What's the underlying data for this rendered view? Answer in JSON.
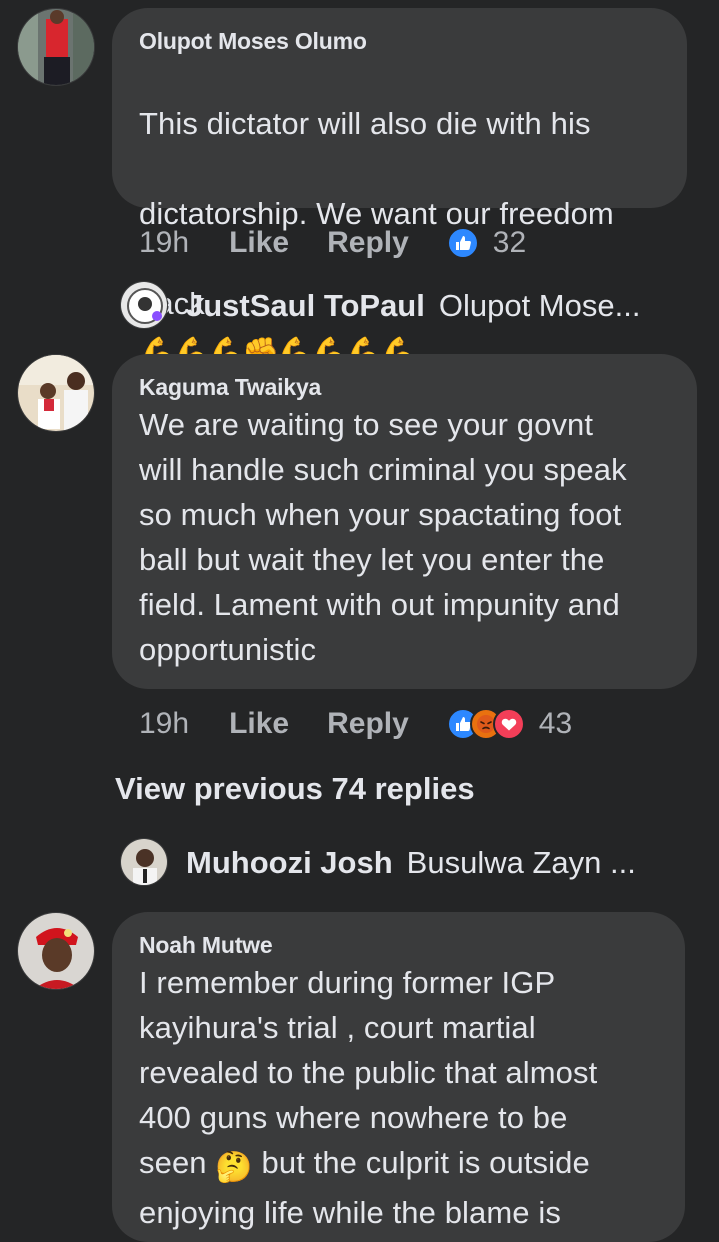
{
  "comments": [
    {
      "author": "Olupot Moses Olumo",
      "text_lines": [
        "This dictator will also die with his",
        "dictatorship. We want our freedom",
        "back"
      ],
      "emoji_trailer": "💪💪💪✊💪💪💪💪",
      "time": "19h",
      "like_label": "Like",
      "reply_label": "Reply",
      "reaction_count": "32",
      "reactions": [
        "like"
      ]
    },
    {
      "author": "Kaguma Twaikya",
      "text": "We are waiting to see your govnt\nwill handle such criminal you speak\nso much when your spactating foot\nball but wait they let you enter the\nfield. Lament with out impunity and\nopportunistic",
      "time": "19h",
      "like_label": "Like",
      "reply_label": "Reply",
      "reaction_count": "43",
      "reactions": [
        "like",
        "angry",
        "love"
      ]
    },
    {
      "author": "Noah Mutwe",
      "text_before_emoji": "I remember during former IGP\nkayihura's trial , court martial\nrevealed to the public that almost\n400 guns where nowhere to be\nseen ",
      "emoji": "🤔",
      "text_after_emoji": " but the culprit is outside\nenjoying life while the blame is"
    }
  ],
  "replies": [
    {
      "name": "JustSaul ToPaul",
      "preview": "Olupot Mose..."
    },
    {
      "name": "Muhoozi Josh",
      "preview": "Busulwa Zayn ..."
    }
  ],
  "view_previous": "View previous 74 replies",
  "colors": {
    "background": "#242526",
    "bubble": "#3a3b3c",
    "text": "#e4e6eb",
    "secondary": "#b0b3b8",
    "like_blue": "#2d88ff"
  }
}
